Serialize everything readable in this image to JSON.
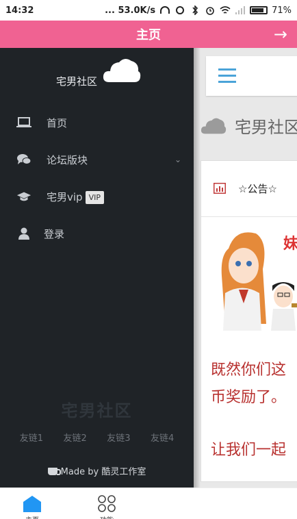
{
  "status_bar": {
    "time": "14:32",
    "net_speed": "... 53.0K/s",
    "battery_percent": "71%"
  },
  "titlebar": {
    "title": "主页",
    "arrow": "→"
  },
  "drawer": {
    "brand": "宅男社区",
    "menu": [
      {
        "label": "首页",
        "icon": "laptop-icon"
      },
      {
        "label": "论坛版块",
        "icon": "comments-icon",
        "has_chevron": true
      },
      {
        "label": "宅男vip",
        "icon": "graduation-cap-icon",
        "badge": "VIP"
      },
      {
        "label": "登录",
        "icon": "user-icon"
      }
    ],
    "chevron": "⌄",
    "footer_brand": "宅男社区",
    "links": [
      "友链1",
      "友链2",
      "友链3",
      "友链4"
    ],
    "made_by": "Made by 酷灵工作室"
  },
  "main": {
    "site_title": "宅男社区",
    "notice_label": "☆公告☆",
    "notice_lines": [
      "既然你们这",
      "币奖励了。"
    ],
    "notice_line3": "让我们一起"
  },
  "tabbar": {
    "tabs": [
      {
        "label": "主页",
        "icon": "home-icon",
        "active": true
      },
      {
        "label": "功能",
        "icon": "grid-icon",
        "active": false
      }
    ]
  },
  "colors": {
    "accent": "#f06292",
    "drawer_bg": "#1f2327",
    "link_blue": "#4aa3d8",
    "notice_red": "#b8312f"
  }
}
